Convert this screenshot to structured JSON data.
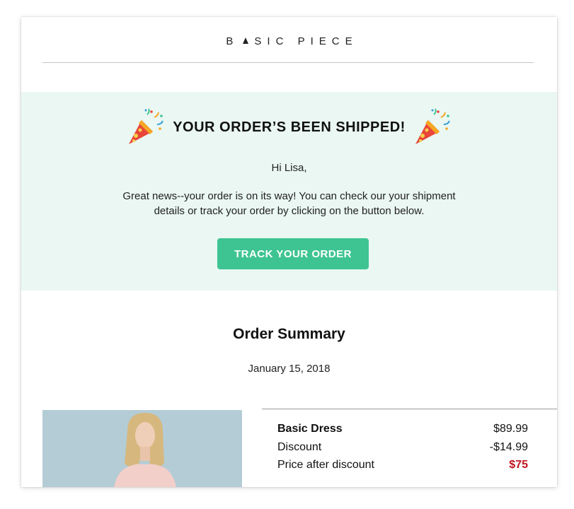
{
  "brand": {
    "name_rest": "SIC PIECE",
    "name_first": "B"
  },
  "hero": {
    "title": "YOUR ORDER’S BEEN SHIPPED!",
    "greeting": "Hi Lisa,",
    "message_line1": "Great news--your order is on its way! You can check our your shipment",
    "message_line2": "details or track your order by clicking on the button below.",
    "button_label": "TRACK YOUR ORDER",
    "icons": [
      "party-popper-icon",
      "party-popper-icon"
    ]
  },
  "summary": {
    "title": "Order Summary",
    "date": "January 15, 2018",
    "items": [
      {
        "label": "Basic Dress",
        "value": "$89.99"
      },
      {
        "label": "Discount",
        "value": "-$14.99"
      },
      {
        "label": "Price after discount",
        "value": "$75"
      }
    ]
  },
  "colors": {
    "hero_background": "#eaf7f2",
    "button": "#3ec493",
    "price_highlight": "#c0151f",
    "product_image_bg": "#b4ccd6"
  }
}
